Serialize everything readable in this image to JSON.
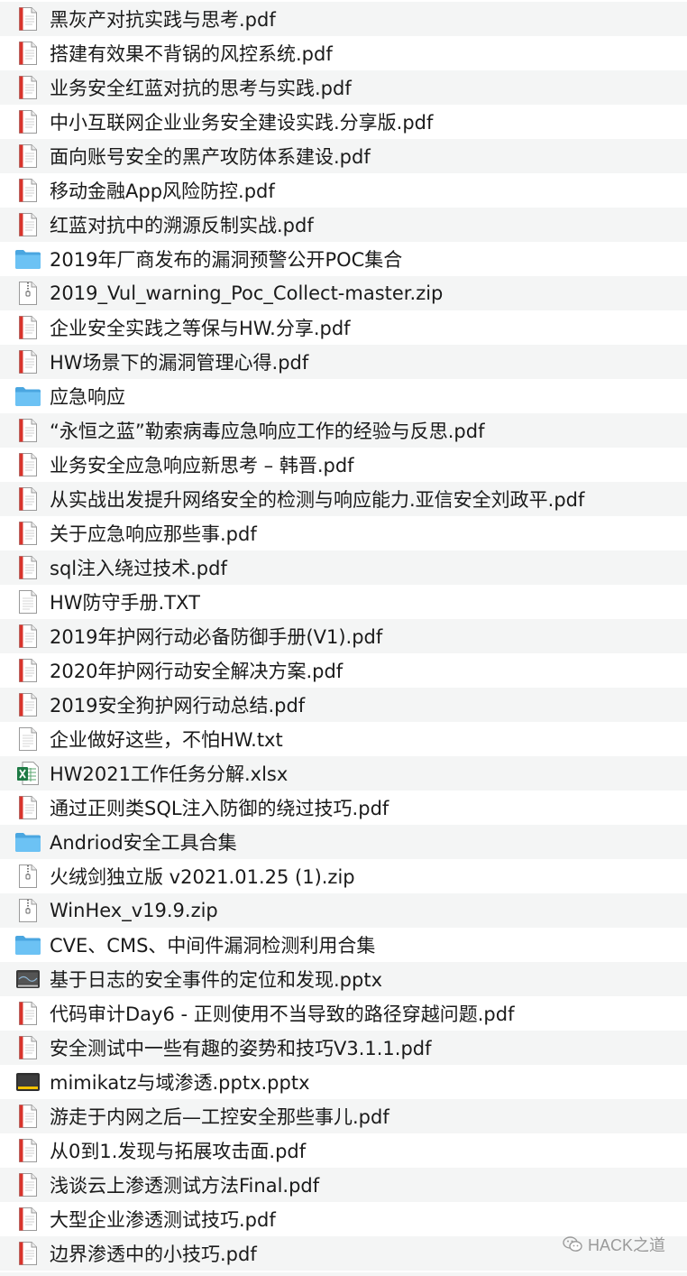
{
  "files": [
    {
      "name": "黑灰产对抗实践与思考.pdf",
      "type": "pdf"
    },
    {
      "name": "搭建有效果不背锅的风控系统.pdf",
      "type": "pdf"
    },
    {
      "name": "业务安全红蓝对抗的思考与实践.pdf",
      "type": "pdf"
    },
    {
      "name": "中小互联网企业业务安全建设实践.分享版.pdf",
      "type": "pdf"
    },
    {
      "name": "面向账号安全的黑产攻防体系建设.pdf",
      "type": "pdf"
    },
    {
      "name": "移动金融App风险防控.pdf",
      "type": "pdf"
    },
    {
      "name": "红蓝对抗中的溯源反制实战.pdf",
      "type": "pdf"
    },
    {
      "name": "2019年厂商发布的漏洞预警公开POC集合",
      "type": "folder"
    },
    {
      "name": "2019_Vul_warning_Poc_Collect-master.zip",
      "type": "zip"
    },
    {
      "name": "企业安全实践之等保与HW.分享.pdf",
      "type": "pdf"
    },
    {
      "name": "HW场景下的漏洞管理心得.pdf",
      "type": "pdf"
    },
    {
      "name": "应急响应",
      "type": "folder"
    },
    {
      "name": "“永恒之蓝”勒索病毒应急响应工作的经验与反思.pdf",
      "type": "pdf"
    },
    {
      "name": "业务安全应急响应新思考 – 韩晋.pdf",
      "type": "pdf"
    },
    {
      "name": "从实战出发提升网络安全的检测与响应能力.亚信安全刘政平.pdf",
      "type": "pdf"
    },
    {
      "name": "关于应急响应那些事.pdf",
      "type": "pdf"
    },
    {
      "name": "sql注入绕过技术.pdf",
      "type": "pdf"
    },
    {
      "name": "HW防守手册.TXT",
      "type": "txt"
    },
    {
      "name": "2019年护网行动必备防御手册(V1).pdf",
      "type": "pdf"
    },
    {
      "name": "2020年护网行动安全解决方案.pdf",
      "type": "pdf"
    },
    {
      "name": "2019安全狗护网行动总结.pdf",
      "type": "pdf"
    },
    {
      "name": "企业做好这些，不怕HW.txt",
      "type": "txt"
    },
    {
      "name": "HW2021工作任务分解.xlsx",
      "type": "xlsx"
    },
    {
      "name": "通过正则类SQL注入防御的绕过技巧.pdf",
      "type": "pdf"
    },
    {
      "name": "Andriod安全工具合集",
      "type": "folder"
    },
    {
      "name": "火绒剑独立版 v2021.01.25 (1).zip",
      "type": "zip"
    },
    {
      "name": "WinHex_v19.9.zip",
      "type": "zip"
    },
    {
      "name": "CVE、CMS、中间件漏洞检测利用合集",
      "type": "folder"
    },
    {
      "name": "基于日志的安全事件的定位和发现.pptx",
      "type": "pptx"
    },
    {
      "name": "代码审计Day6 - 正则使用不当导致的路径穿越问题.pdf",
      "type": "pdf"
    },
    {
      "name": "安全测试中一些有趣的姿势和技巧V3.1.1.pdf",
      "type": "pdf"
    },
    {
      "name": "mimikatz与域渗透.pptx.pptx",
      "type": "pptx-yellow"
    },
    {
      "name": "游走于内网之后—工控安全那些事儿.pdf",
      "type": "pdf"
    },
    {
      "name": "从0到1.发现与拓展攻击面.pdf",
      "type": "pdf"
    },
    {
      "name": "浅谈云上渗透测试方法Final.pdf",
      "type": "pdf"
    },
    {
      "name": "大型企业渗透测试技巧.pdf",
      "type": "pdf"
    },
    {
      "name": "边界渗透中的小技巧.pdf",
      "type": "pdf"
    }
  ],
  "watermark": {
    "text": "HACK之道"
  },
  "colors": {
    "row_alt": "#f4f5f5",
    "folder": "#5bb8f0",
    "pdf_band": "#d8342c",
    "xlsx": "#1e7a45",
    "watermark": "#9a9a9a"
  }
}
